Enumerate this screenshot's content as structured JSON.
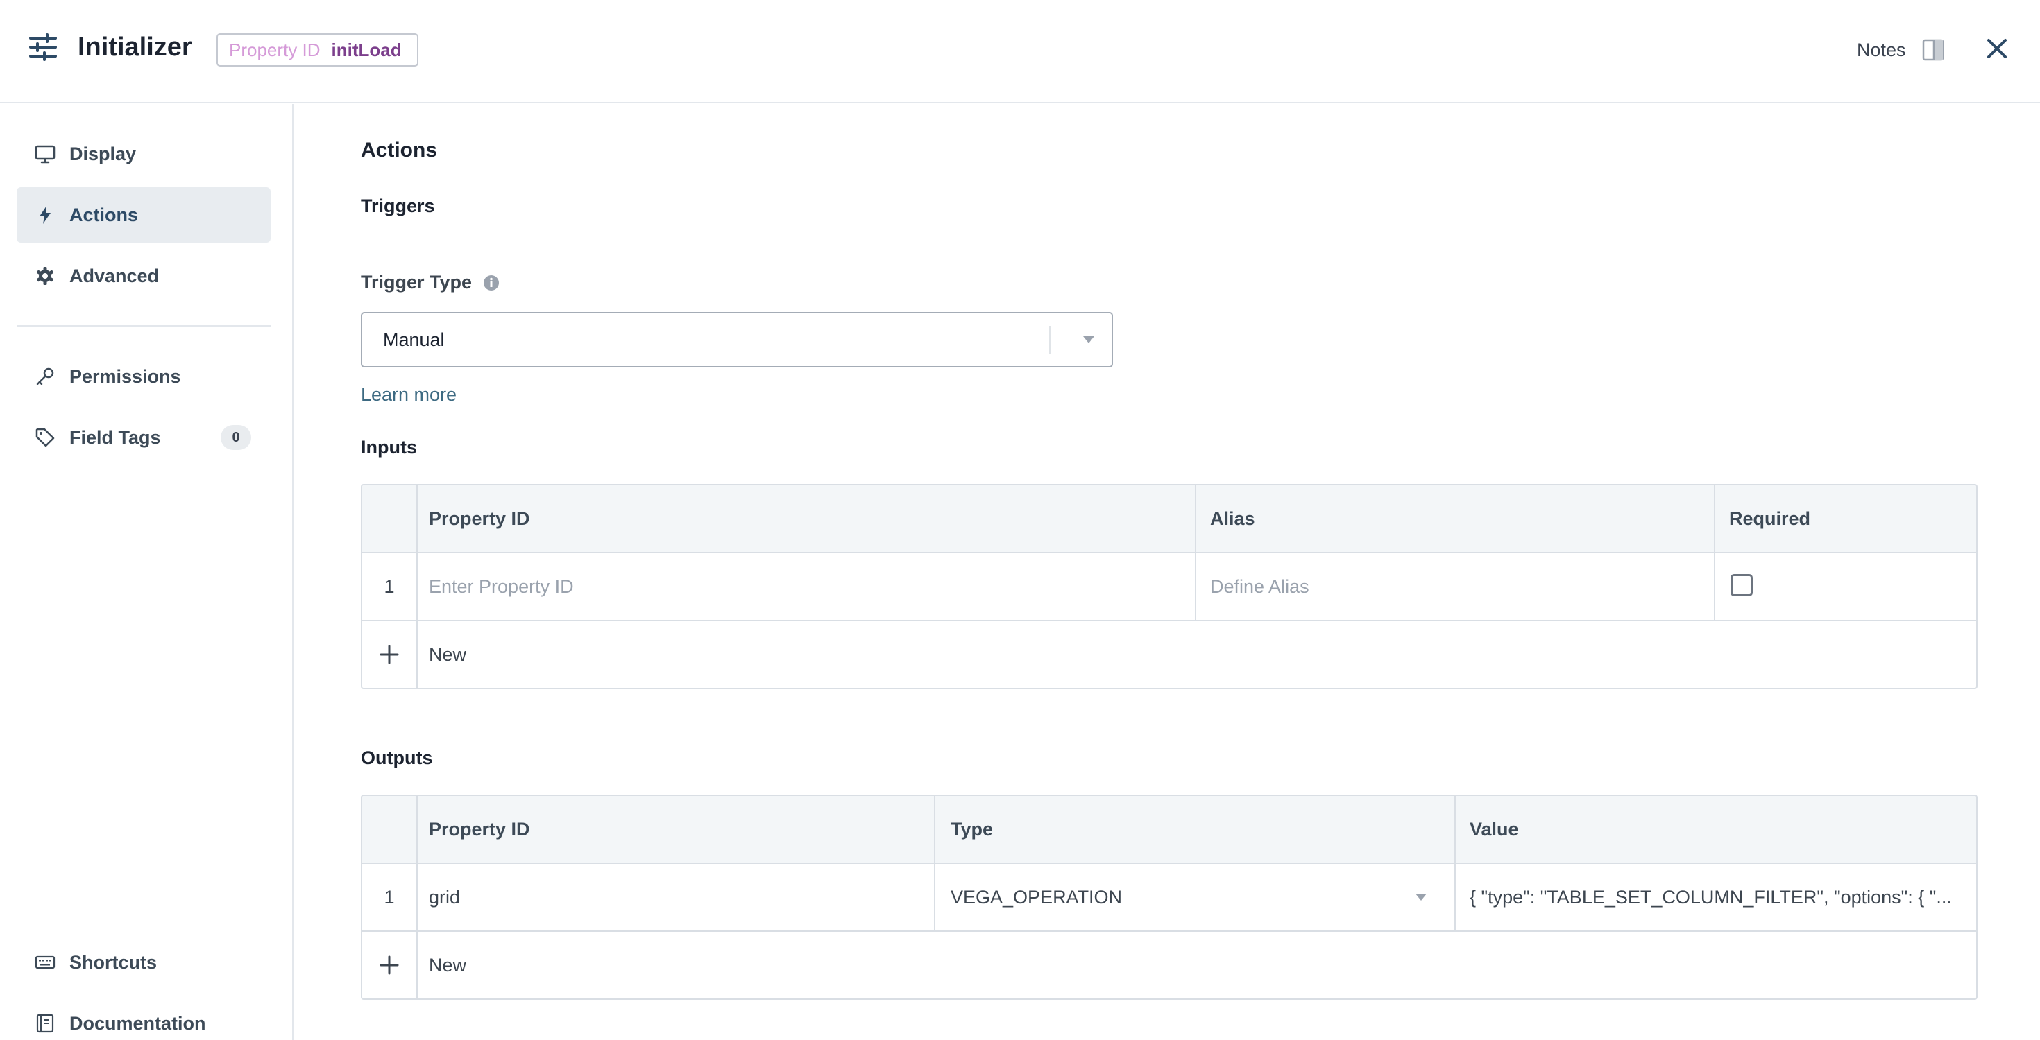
{
  "header": {
    "title": "Initializer",
    "property_id_label": "Property ID",
    "property_id_value": "initLoad",
    "notes_label": "Notes"
  },
  "sidebar": {
    "items": [
      {
        "label": "Display",
        "icon": "monitor-icon",
        "active": false
      },
      {
        "label": "Actions",
        "icon": "lightning-icon",
        "active": true
      },
      {
        "label": "Advanced",
        "icon": "gear-icon",
        "active": false
      },
      {
        "label": "Permissions",
        "icon": "key-icon",
        "active": false
      },
      {
        "label": "Field Tags",
        "icon": "tag-icon",
        "active": false,
        "badge": "0"
      }
    ],
    "footer": [
      {
        "label": "Shortcuts",
        "icon": "keyboard-icon"
      },
      {
        "label": "Documentation",
        "icon": "book-icon"
      }
    ]
  },
  "main": {
    "section_title": "Actions",
    "triggers_title": "Triggers",
    "trigger_type_label": "Trigger Type",
    "trigger_type_value": "Manual",
    "learn_more": "Learn more",
    "inputs": {
      "title": "Inputs",
      "columns": [
        "Property ID",
        "Alias",
        "Required"
      ],
      "rows": [
        {
          "index": "1",
          "property_id_placeholder": "Enter Property ID",
          "alias_placeholder": "Define Alias",
          "required": false
        }
      ],
      "new_label": "New"
    },
    "outputs": {
      "title": "Outputs",
      "columns": [
        "Property ID",
        "Type",
        "Value"
      ],
      "rows": [
        {
          "index": "1",
          "property_id": "grid",
          "type": "VEGA_OPERATION",
          "value": "{ \"type\": \"TABLE_SET_COLUMN_FILTER\", \"options\": { \"..."
        }
      ],
      "new_label": "New"
    }
  },
  "colors": {
    "accent_text": "#2d4a66",
    "link": "#3d6a82",
    "active_bg": "#e8ecf0",
    "badge_label": "#d59ad8",
    "badge_value": "#7c3f8c"
  }
}
